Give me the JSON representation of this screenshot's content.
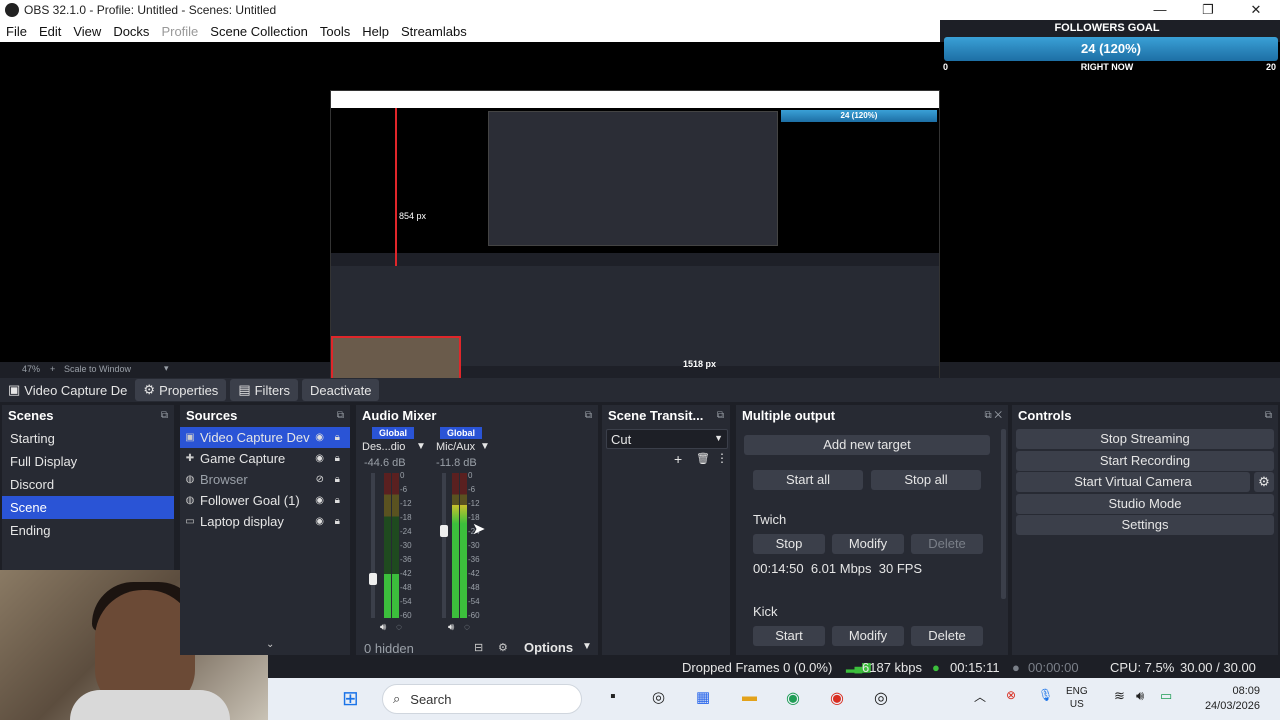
{
  "window": {
    "title": "OBS 32.1.0 - Profile: Untitled - Scenes: Untitled",
    "minimize": "—",
    "restore": "❐",
    "close": "✕"
  },
  "menu": [
    "File",
    "Edit",
    "View",
    "Docks",
    "Profile",
    "Scene Collection",
    "Tools",
    "Help",
    "Streamlabs"
  ],
  "goal": {
    "title": "FOLLOWERS GOAL",
    "value": "24 (120%)",
    "min": "0",
    "subtitle": "RIGHT NOW",
    "max": "20",
    "progress": 1.0
  },
  "preview": {
    "measure_v": "854 px",
    "measure_h": "1518 px",
    "nested_goal": "24 (120%)"
  },
  "scale": {
    "zoom": "47%",
    "mode": "Scale to Window"
  },
  "context": {
    "source": "Video Capture De",
    "properties": "Properties",
    "filters": "Filters",
    "deactivate": "Deactivate"
  },
  "scenes": {
    "title": "Scenes",
    "items": [
      "Starting",
      "Full Display",
      "Discord",
      "Scene",
      "Ending"
    ],
    "active_index": 3
  },
  "sources": {
    "title": "Sources",
    "items": [
      {
        "label": "Video Capture Dev",
        "icon": "camera-icon"
      },
      {
        "label": "Game Capture",
        "icon": "gamepad-icon"
      },
      {
        "label": "Browser",
        "icon": "globe-icon"
      },
      {
        "label": "Follower Goal (1)",
        "icon": "globe-icon"
      },
      {
        "label": "Laptop display",
        "icon": "monitor-icon"
      }
    ]
  },
  "mixer": {
    "title": "Audio Mixer",
    "channels": [
      {
        "tag": "Global",
        "name": "Des...dio",
        "db": "-44.6 dB",
        "level": 0.3
      },
      {
        "tag": "Global",
        "name": "Mic/Aux",
        "db": "-11.8 dB",
        "level": 0.78
      }
    ],
    "ticks": [
      "0",
      "-6",
      "-12",
      "-18",
      "-24",
      "-30",
      "-36",
      "-42",
      "-48",
      "-54",
      "-60"
    ],
    "hidden": "0 hidden",
    "options": "Options"
  },
  "transitions": {
    "title": "Scene Transit...",
    "selected": "Cut"
  },
  "multi": {
    "title": "Multiple output",
    "add": "Add new target",
    "start_all": "Start all",
    "stop_all": "Stop all",
    "targets": [
      {
        "name": "Twich",
        "primary": "Stop",
        "modify": "Modify",
        "delete": "Delete",
        "stats": "00:14:50  6.01 Mbps  30 FPS"
      },
      {
        "name": "Kick",
        "primary": "Start",
        "modify": "Modify",
        "delete": "Delete"
      }
    ]
  },
  "controls": {
    "title": "Controls",
    "buttons": [
      "Stop Streaming",
      "Start Recording",
      "Start Virtual Camera",
      "Studio Mode",
      "Settings"
    ]
  },
  "status": {
    "dropped": "Dropped Frames 0 (0.0%)",
    "bitrate": "6187 kbps",
    "stream_time": "00:15:11",
    "rec_time": "00:00:00",
    "cpu": "CPU: 7.5%",
    "fps": "30.00 / 30.00 FPS"
  },
  "taskbar": {
    "search": "Search",
    "lang": "ENG",
    "region": "US",
    "time": "08:09",
    "date": "24/03/2026"
  },
  "colors": {
    "accent": "#2a54d6",
    "dock_bg": "#272a33",
    "meter_green": "#3cbf3c",
    "live_red": "#e0262a"
  }
}
